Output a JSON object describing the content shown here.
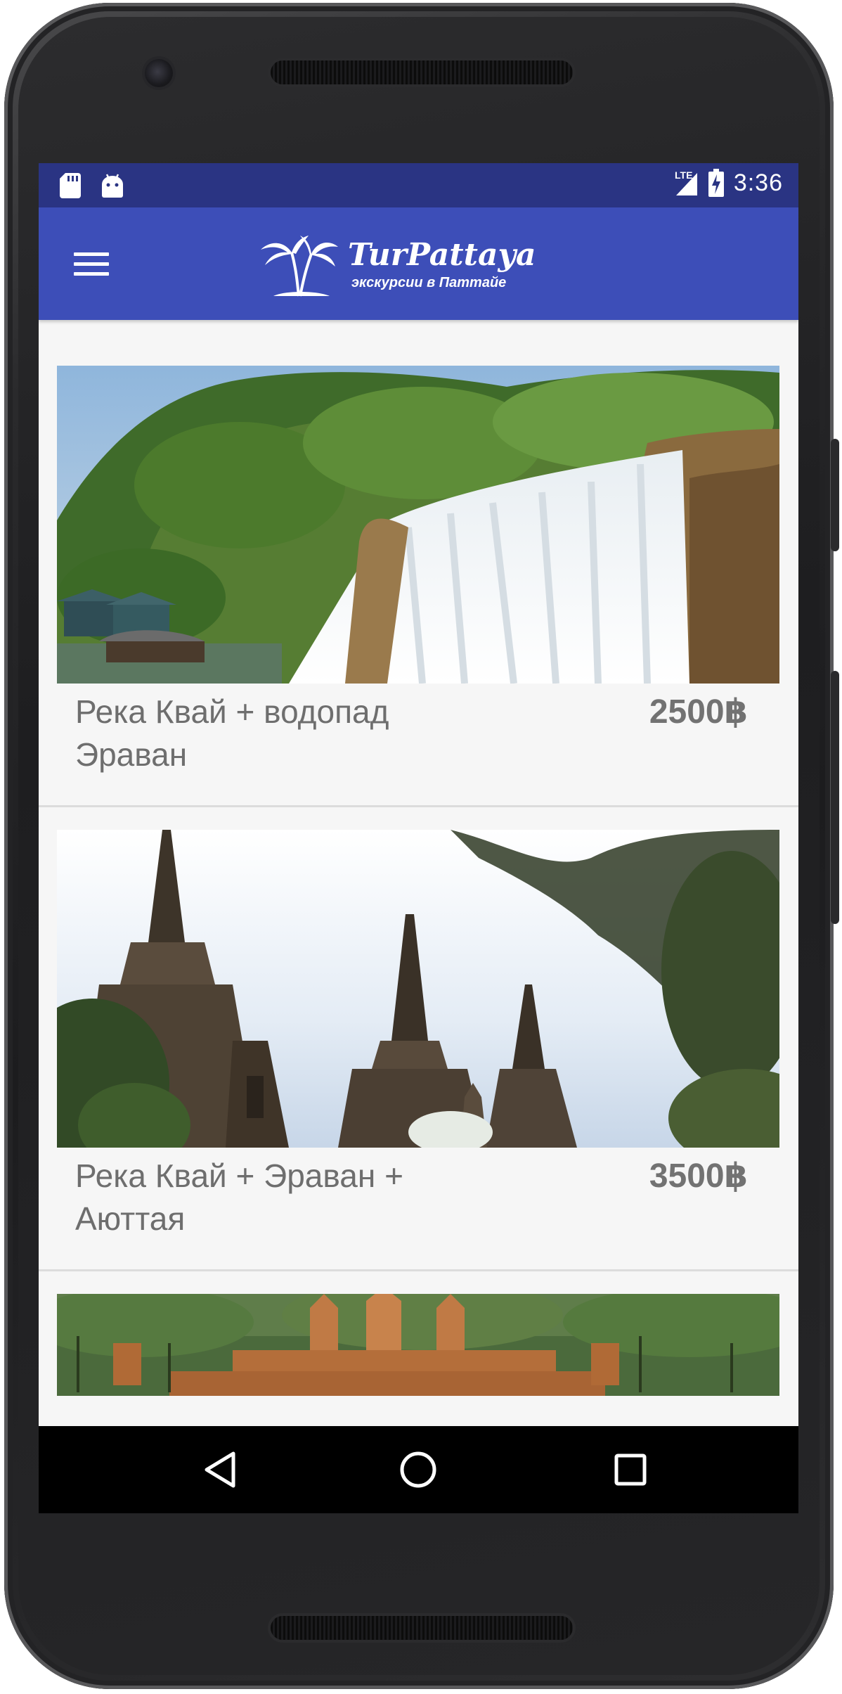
{
  "status_bar": {
    "network": "LTE",
    "time": "3:36"
  },
  "app_bar": {
    "logo_title": "TurPattaya",
    "logo_subtitle": "экскурсии в Паттайе"
  },
  "tours": [
    {
      "title": "Река Квай + водопад Эраван",
      "price": "2500฿",
      "image": "waterfall-photo"
    },
    {
      "title": "Река Квай + Эраван + Аюттая",
      "price": "3500฿",
      "image": "ayutthaya-temples-photo"
    },
    {
      "title": "",
      "price": "",
      "image": "angkor-wat-photo"
    }
  ],
  "nav": {
    "back": "back-icon",
    "home": "home-icon",
    "recents": "recents-icon"
  },
  "colors": {
    "status_bar": "#2a3483",
    "app_bar": "#3d4eb8",
    "screen_bg": "#f6f6f6",
    "text": "#6e6e6e"
  }
}
